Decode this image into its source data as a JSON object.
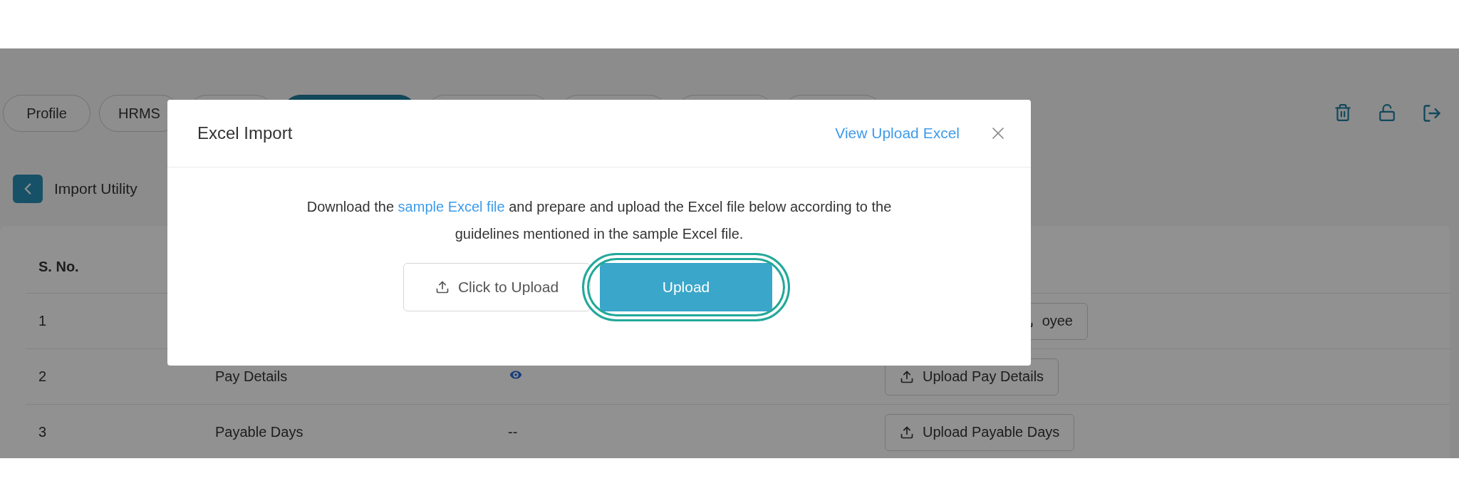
{
  "tabs": [
    {
      "label": "Profile",
      "selected": false
    },
    {
      "label": "HRMS",
      "selected": false
    },
    {
      "selected": false
    },
    {
      "selected": true
    },
    {
      "selected": false
    },
    {
      "selected": false
    },
    {
      "selected": false
    },
    {
      "selected": false
    }
  ],
  "page_title": "Import Utility",
  "table": {
    "columns": [
      "S. No."
    ],
    "rows": [
      {
        "sno": "1",
        "action": "oyee",
        "action_wide": true
      },
      {
        "sno": "2",
        "name": "Pay Details",
        "view": {
          "kind": "icon"
        },
        "action": "Upload Pay Details"
      },
      {
        "sno": "3",
        "name": "Payable Days",
        "view": {
          "kind": "text",
          "text": "--"
        },
        "action": "Upload Payable Days"
      }
    ]
  },
  "modal": {
    "title": "Excel Import",
    "link": "View Upload Excel",
    "message_before": "Download the ",
    "message_link": "sample Excel file",
    "message_after": " and prepare and upload the Excel file below according to the guidelines mentioned in the sample Excel file.",
    "buttons": [
      {
        "kind": "outline",
        "label": "Click to Upload"
      },
      {
        "kind": "primary",
        "label": "Upload",
        "highlighted": true
      }
    ]
  }
}
